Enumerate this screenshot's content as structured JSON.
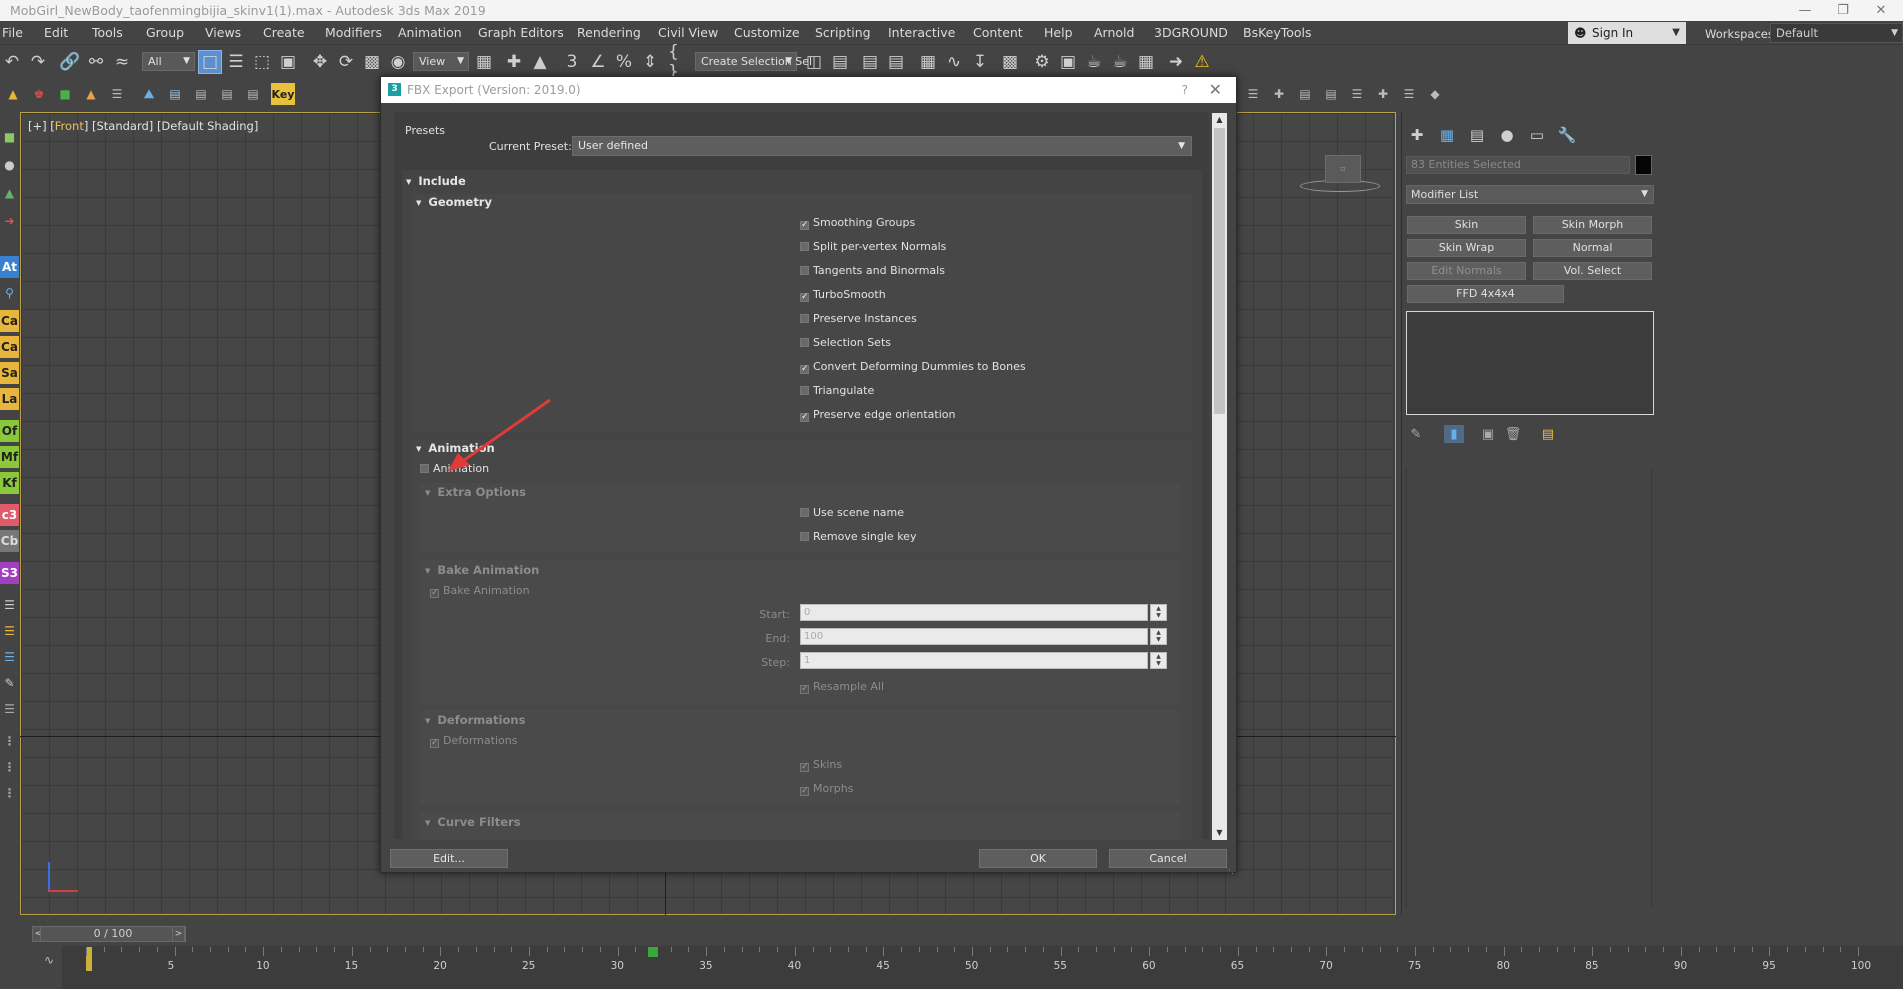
{
  "window": {
    "title": "MobGirl_NewBody_taofenmingbijia_skinv1(1).max - Autodesk 3ds Max 2019"
  },
  "menu": [
    "File",
    "Edit",
    "Tools",
    "Group",
    "Views",
    "Create",
    "Modifiers",
    "Animation",
    "Graph Editors",
    "Rendering",
    "Civil View",
    "Customize",
    "Scripting",
    "Interactive",
    "Content",
    "Help",
    "Arnold",
    "3DGROUND",
    "BsKeyTools"
  ],
  "account": {
    "sign_in": "Sign In",
    "workspaces_label": "Workspaces:",
    "workspace": "Default"
  },
  "toolbar": {
    "filter": "All",
    "ref_coord": "View",
    "selection_set": "Create Selection Sel"
  },
  "toolbar2": {
    "key_label": "Key"
  },
  "viewport": {
    "label_prefix": "[+] [",
    "view": "Front",
    "label_suffix": "] [Standard] [Default Shading]"
  },
  "command_panel": {
    "entities": "83 Entities Selected",
    "modifier_list": "Modifier List",
    "buttons": [
      "Skin",
      "Skin Morph",
      "Skin Wrap",
      "Normal",
      "Edit Normals",
      "Vol. Select",
      "FFD 4x4x4"
    ]
  },
  "timeline": {
    "slider": "0 / 100",
    "ticks": [
      "5",
      "10",
      "15",
      "20",
      "25",
      "30",
      "35",
      "40",
      "45",
      "50",
      "55",
      "60",
      "65",
      "70",
      "75",
      "80",
      "85",
      "90",
      "95",
      "100"
    ]
  },
  "dialog": {
    "title": "FBX Export (Version: 2019.0)",
    "help": "?",
    "presets": "Presets",
    "current_preset_label": "Current Preset:",
    "current_preset": "User defined",
    "include": "Include",
    "geometry": "Geometry",
    "geometry_options": [
      {
        "label": "Smoothing Groups",
        "checked": true
      },
      {
        "label": "Split per-vertex Normals",
        "checked": false
      },
      {
        "label": "Tangents and Binormals",
        "checked": false
      },
      {
        "label": "TurboSmooth",
        "checked": true
      },
      {
        "label": "Preserve Instances",
        "checked": false
      },
      {
        "label": "Selection Sets",
        "checked": false
      },
      {
        "label": "Convert Deforming Dummies to Bones",
        "checked": true
      },
      {
        "label": "Triangulate",
        "checked": false
      },
      {
        "label": "Preserve edge orientation",
        "checked": true
      }
    ],
    "animation_title": "Animation",
    "animation_checkbox": "Animation",
    "extra_options": "Extra Options",
    "use_scene_name": "Use scene name",
    "remove_single_key": "Remove single key",
    "bake_animation_title": "Bake Animation",
    "bake_animation_checkbox": "Bake Animation",
    "start_label": "Start:",
    "end_label": "End:",
    "step_label": "Step:",
    "start_value": "0",
    "end_value": "100",
    "step_value": "1",
    "resample_all": "Resample All",
    "deformations_title": "Deformations",
    "deformations_checkbox": "Deformations",
    "skins": "Skins",
    "morphs": "Morphs",
    "curve_filters": "Curve Filters",
    "edit_button": "Edit...",
    "ok_button": "OK",
    "cancel_button": "Cancel"
  },
  "colors": {
    "accent_yellow": "#e8c35a",
    "arrow_red": "#e03a3a",
    "viewport_border": "#b8a04a"
  }
}
